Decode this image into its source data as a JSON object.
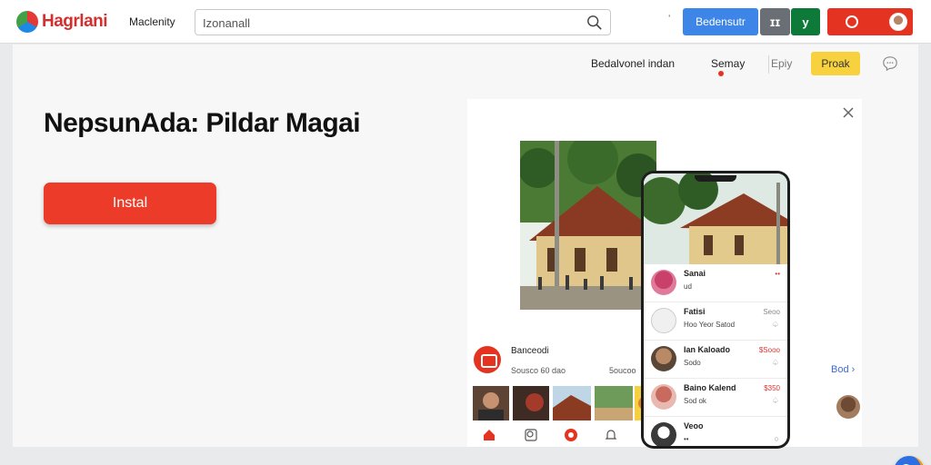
{
  "header": {
    "logo_text": "Hagrlani",
    "brand_sub": "Maclenity",
    "search_value": "Izonanall",
    "chevron": "ˈ",
    "blue_btn": "Bedensutr",
    "grey_btn": "ɪɪ",
    "green_btn": "y"
  },
  "subnav": {
    "item1": "Bedalvonel indan",
    "item2": "Semay",
    "item3": "Epiy",
    "yellow_btn": "Proak"
  },
  "hero": {
    "title": "NepsunAda: Pildar Magai",
    "install_label": "Instal"
  },
  "preview": {
    "app_name": "Banceodi",
    "app_meta": "Sousco 60 dao",
    "app_meta2": "5oucoo",
    "right_meta": "Bod ›",
    "phone_rows": [
      {
        "name": "Sanai",
        "sub": "ud",
        "price": "••",
        "mini": ""
      },
      {
        "name": "Fatisi",
        "sub": "Hoo Yeor Satod",
        "price": "Seoo",
        "mini": "♤"
      },
      {
        "name": "Ian Kaloado",
        "sub": "Sodo",
        "price": "$Sooo",
        "mini": "♤"
      },
      {
        "name": "Baino Kalend",
        "sub": "Sod ok",
        "price": "$350",
        "mini": "♤"
      },
      {
        "name": "Veoo",
        "sub": "••",
        "price": "",
        "mini": "○"
      }
    ]
  },
  "colors": {
    "accent_red": "#ec3b28",
    "accent_blue": "#3d86e8",
    "accent_green": "#0d7a3a",
    "accent_yellow": "#f7d23e"
  }
}
